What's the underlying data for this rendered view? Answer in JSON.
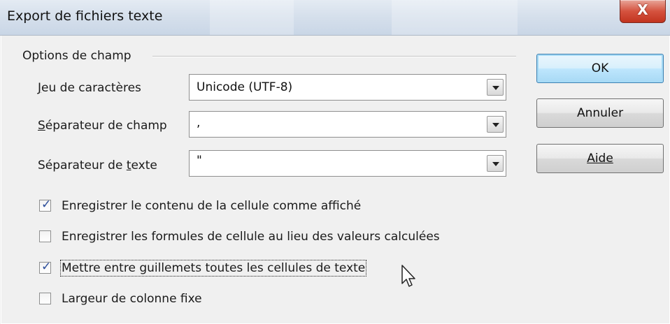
{
  "window": {
    "title": "Export de fichiers texte",
    "close_label": "X"
  },
  "field_options": {
    "group_label": "Options de champ",
    "charset_label": "Jeu de caractères",
    "charset_value": "Unicode (UTF-8)",
    "field_separator_label": "Séparateur de champ",
    "field_separator_value": ",",
    "text_separator_label": "Séparateur de texte",
    "text_separator_value": "\""
  },
  "checkboxes": [
    {
      "label": "Enregistrer le contenu de la cellule comme affiché",
      "checked": true
    },
    {
      "label": "Enregistrer les formules de cellule au lieu des valeurs calculées",
      "checked": false
    },
    {
      "label": "Mettre entre guillemets toutes les cellules de texte",
      "checked": true
    },
    {
      "label": "Largeur de colonne fixe",
      "checked": false
    }
  ],
  "buttons": {
    "ok": "OK",
    "cancel": "Annuler",
    "help": "Aide"
  },
  "icons": {
    "checkmark": "✓",
    "dropdown": "chevron-down-icon",
    "cursor": "mouse-pointer-icon"
  },
  "colors": {
    "default_button_border": "#3c7fb1",
    "close_button": "#c2341f",
    "check_color": "#2a4c9a"
  }
}
